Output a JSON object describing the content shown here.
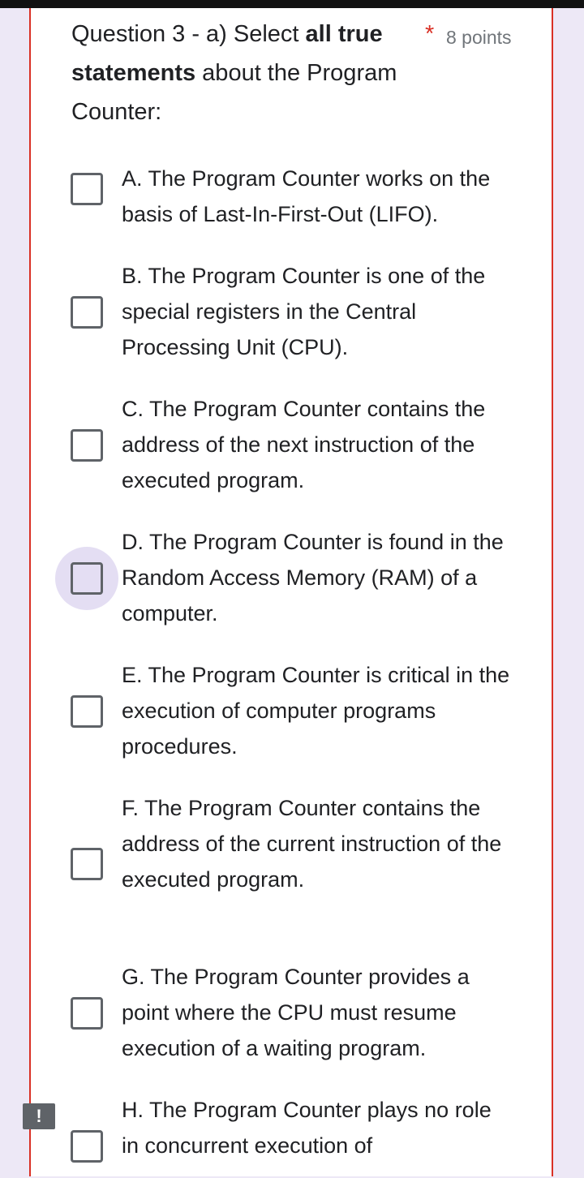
{
  "question": {
    "prefix": "Question 3 - a)  Select ",
    "bold1": "all true",
    "bold2": "statements",
    "suffix": " about the Program Counter:",
    "required_mark": "*",
    "points": "8 points"
  },
  "options": [
    {
      "label": "A. The Program Counter works on the basis of Last-In-First-Out (LIFO)."
    },
    {
      "label": "B. The Program Counter is one of the special registers in the Central Processing Unit (CPU)."
    },
    {
      "label": "C. The Program Counter contains the address of the next instruction of the executed program."
    },
    {
      "label": "D. The Program Counter is found in the Random Access Memory (RAM) of a computer."
    },
    {
      "label": "E. The Program Counter is critical in the execution of computer programs procedures."
    },
    {
      "label": "F. The Program Counter contains the address of the current instruction of the executed program."
    },
    {
      "label": "G. The Program Counter provides a point where the CPU must resume execution of a waiting program."
    },
    {
      "label": "H. The Program Counter plays no role in concurrent execution of"
    }
  ],
  "error_flag": "!",
  "colors": {
    "background": "#ede8f6",
    "error_border": "#d93025",
    "focus_ring": "#e4def3",
    "checkbox": "#5f6368"
  }
}
